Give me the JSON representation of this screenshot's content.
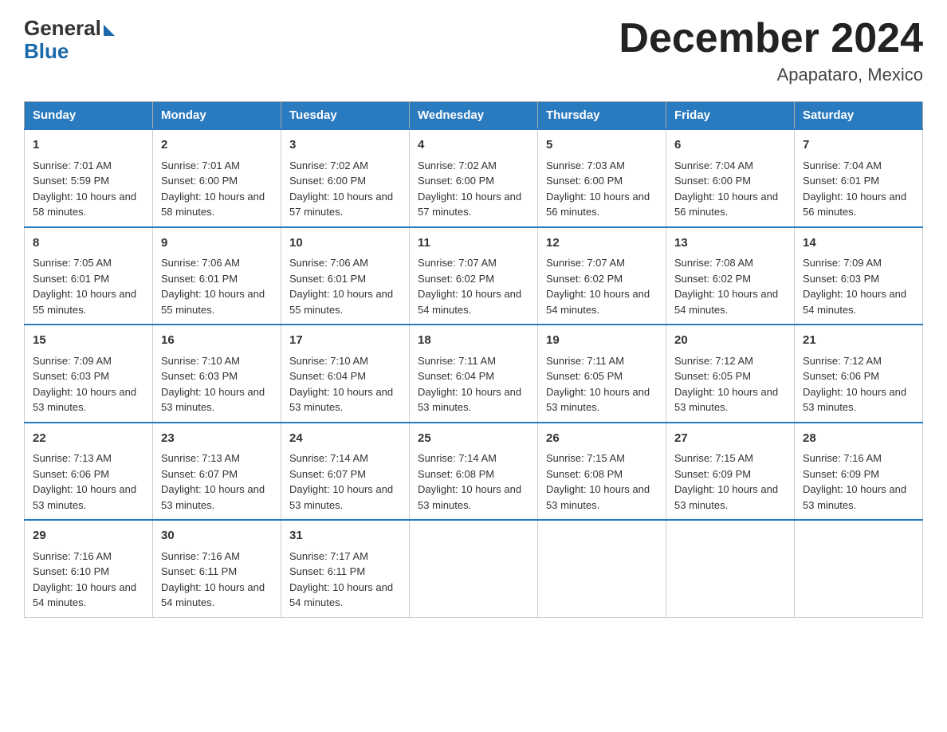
{
  "logo": {
    "general": "General",
    "blue": "Blue"
  },
  "title": "December 2024",
  "location": "Apapataro, Mexico",
  "days_of_week": [
    "Sunday",
    "Monday",
    "Tuesday",
    "Wednesday",
    "Thursday",
    "Friday",
    "Saturday"
  ],
  "weeks": [
    [
      {
        "day": "1",
        "sunrise": "7:01 AM",
        "sunset": "5:59 PM",
        "daylight": "10 hours and 58 minutes."
      },
      {
        "day": "2",
        "sunrise": "7:01 AM",
        "sunset": "6:00 PM",
        "daylight": "10 hours and 58 minutes."
      },
      {
        "day": "3",
        "sunrise": "7:02 AM",
        "sunset": "6:00 PM",
        "daylight": "10 hours and 57 minutes."
      },
      {
        "day": "4",
        "sunrise": "7:02 AM",
        "sunset": "6:00 PM",
        "daylight": "10 hours and 57 minutes."
      },
      {
        "day": "5",
        "sunrise": "7:03 AM",
        "sunset": "6:00 PM",
        "daylight": "10 hours and 56 minutes."
      },
      {
        "day": "6",
        "sunrise": "7:04 AM",
        "sunset": "6:00 PM",
        "daylight": "10 hours and 56 minutes."
      },
      {
        "day": "7",
        "sunrise": "7:04 AM",
        "sunset": "6:01 PM",
        "daylight": "10 hours and 56 minutes."
      }
    ],
    [
      {
        "day": "8",
        "sunrise": "7:05 AM",
        "sunset": "6:01 PM",
        "daylight": "10 hours and 55 minutes."
      },
      {
        "day": "9",
        "sunrise": "7:06 AM",
        "sunset": "6:01 PM",
        "daylight": "10 hours and 55 minutes."
      },
      {
        "day": "10",
        "sunrise": "7:06 AM",
        "sunset": "6:01 PM",
        "daylight": "10 hours and 55 minutes."
      },
      {
        "day": "11",
        "sunrise": "7:07 AM",
        "sunset": "6:02 PM",
        "daylight": "10 hours and 54 minutes."
      },
      {
        "day": "12",
        "sunrise": "7:07 AM",
        "sunset": "6:02 PM",
        "daylight": "10 hours and 54 minutes."
      },
      {
        "day": "13",
        "sunrise": "7:08 AM",
        "sunset": "6:02 PM",
        "daylight": "10 hours and 54 minutes."
      },
      {
        "day": "14",
        "sunrise": "7:09 AM",
        "sunset": "6:03 PM",
        "daylight": "10 hours and 54 minutes."
      }
    ],
    [
      {
        "day": "15",
        "sunrise": "7:09 AM",
        "sunset": "6:03 PM",
        "daylight": "10 hours and 53 minutes."
      },
      {
        "day": "16",
        "sunrise": "7:10 AM",
        "sunset": "6:03 PM",
        "daylight": "10 hours and 53 minutes."
      },
      {
        "day": "17",
        "sunrise": "7:10 AM",
        "sunset": "6:04 PM",
        "daylight": "10 hours and 53 minutes."
      },
      {
        "day": "18",
        "sunrise": "7:11 AM",
        "sunset": "6:04 PM",
        "daylight": "10 hours and 53 minutes."
      },
      {
        "day": "19",
        "sunrise": "7:11 AM",
        "sunset": "6:05 PM",
        "daylight": "10 hours and 53 minutes."
      },
      {
        "day": "20",
        "sunrise": "7:12 AM",
        "sunset": "6:05 PM",
        "daylight": "10 hours and 53 minutes."
      },
      {
        "day": "21",
        "sunrise": "7:12 AM",
        "sunset": "6:06 PM",
        "daylight": "10 hours and 53 minutes."
      }
    ],
    [
      {
        "day": "22",
        "sunrise": "7:13 AM",
        "sunset": "6:06 PM",
        "daylight": "10 hours and 53 minutes."
      },
      {
        "day": "23",
        "sunrise": "7:13 AM",
        "sunset": "6:07 PM",
        "daylight": "10 hours and 53 minutes."
      },
      {
        "day": "24",
        "sunrise": "7:14 AM",
        "sunset": "6:07 PM",
        "daylight": "10 hours and 53 minutes."
      },
      {
        "day": "25",
        "sunrise": "7:14 AM",
        "sunset": "6:08 PM",
        "daylight": "10 hours and 53 minutes."
      },
      {
        "day": "26",
        "sunrise": "7:15 AM",
        "sunset": "6:08 PM",
        "daylight": "10 hours and 53 minutes."
      },
      {
        "day": "27",
        "sunrise": "7:15 AM",
        "sunset": "6:09 PM",
        "daylight": "10 hours and 53 minutes."
      },
      {
        "day": "28",
        "sunrise": "7:16 AM",
        "sunset": "6:09 PM",
        "daylight": "10 hours and 53 minutes."
      }
    ],
    [
      {
        "day": "29",
        "sunrise": "7:16 AM",
        "sunset": "6:10 PM",
        "daylight": "10 hours and 54 minutes."
      },
      {
        "day": "30",
        "sunrise": "7:16 AM",
        "sunset": "6:11 PM",
        "daylight": "10 hours and 54 minutes."
      },
      {
        "day": "31",
        "sunrise": "7:17 AM",
        "sunset": "6:11 PM",
        "daylight": "10 hours and 54 minutes."
      },
      null,
      null,
      null,
      null
    ]
  ],
  "labels": {
    "sunrise_prefix": "Sunrise: ",
    "sunset_prefix": "Sunset: ",
    "daylight_prefix": "Daylight: "
  }
}
